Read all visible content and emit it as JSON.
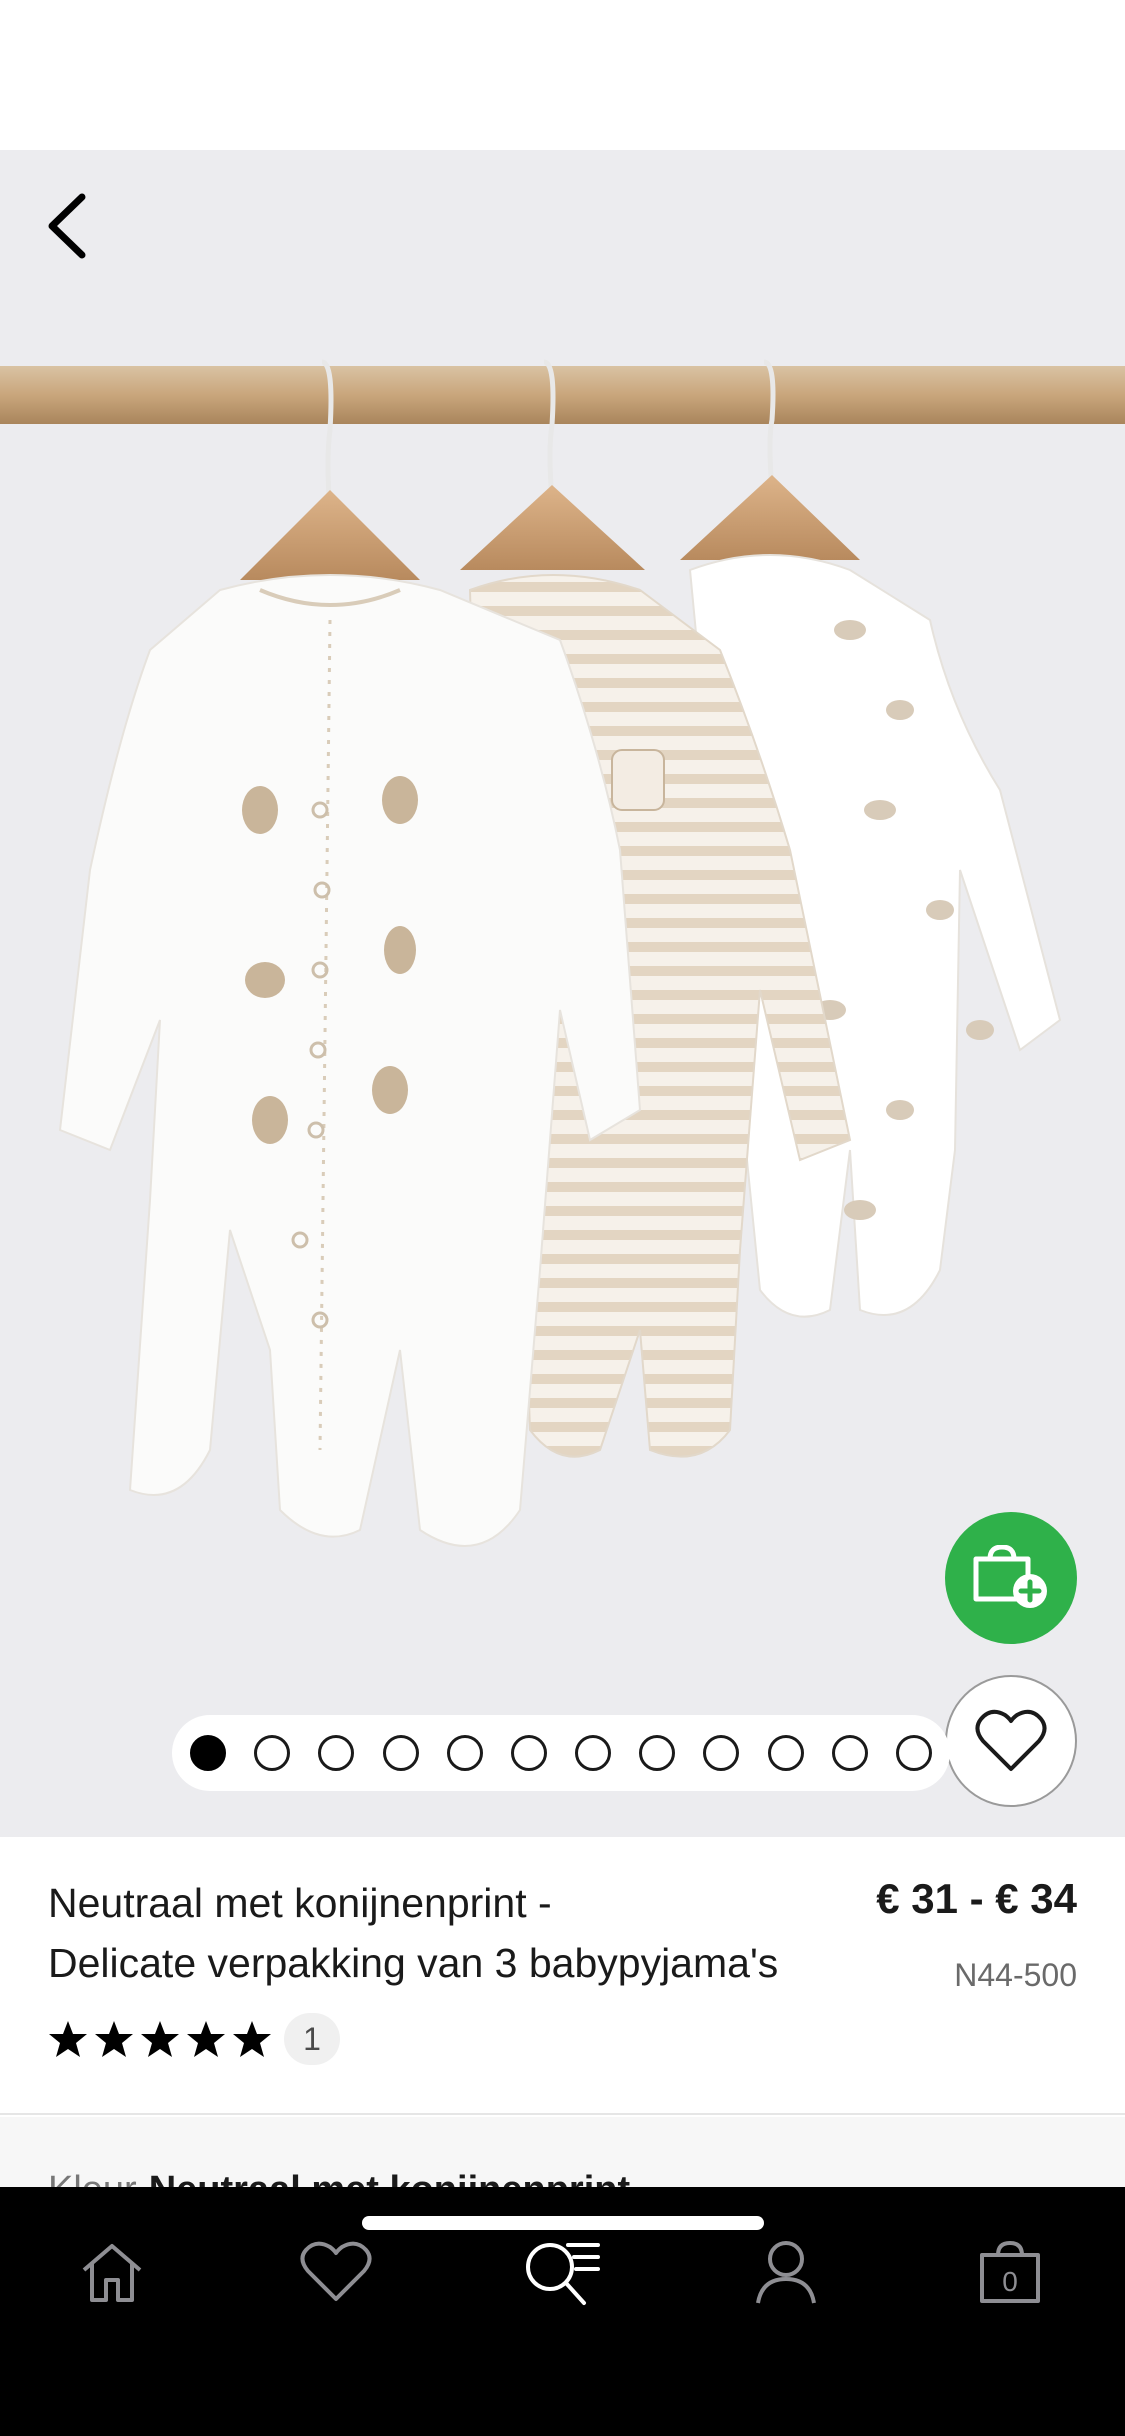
{
  "product": {
    "title_line1": "Neutraal met konijnenprint -",
    "title_line2": "Delicate verpakking van 3 babypyjama's",
    "price": "€ 31 - € 34",
    "code": "N44-500",
    "rating_stars": 5,
    "review_count": "1"
  },
  "gallery": {
    "image_count": 12,
    "active_index": 0
  },
  "colour": {
    "label": "Kleur",
    "value": "Neutraal met konijnenprint"
  },
  "tabbar": {
    "items": [
      "home-icon",
      "heart-icon",
      "search-menu-icon",
      "account-icon",
      "bag-icon"
    ],
    "bag_count": "0"
  },
  "colors": {
    "accent_green": "#2fb14a",
    "tab_bar": "#000000",
    "gallery_background": "#ececef"
  }
}
